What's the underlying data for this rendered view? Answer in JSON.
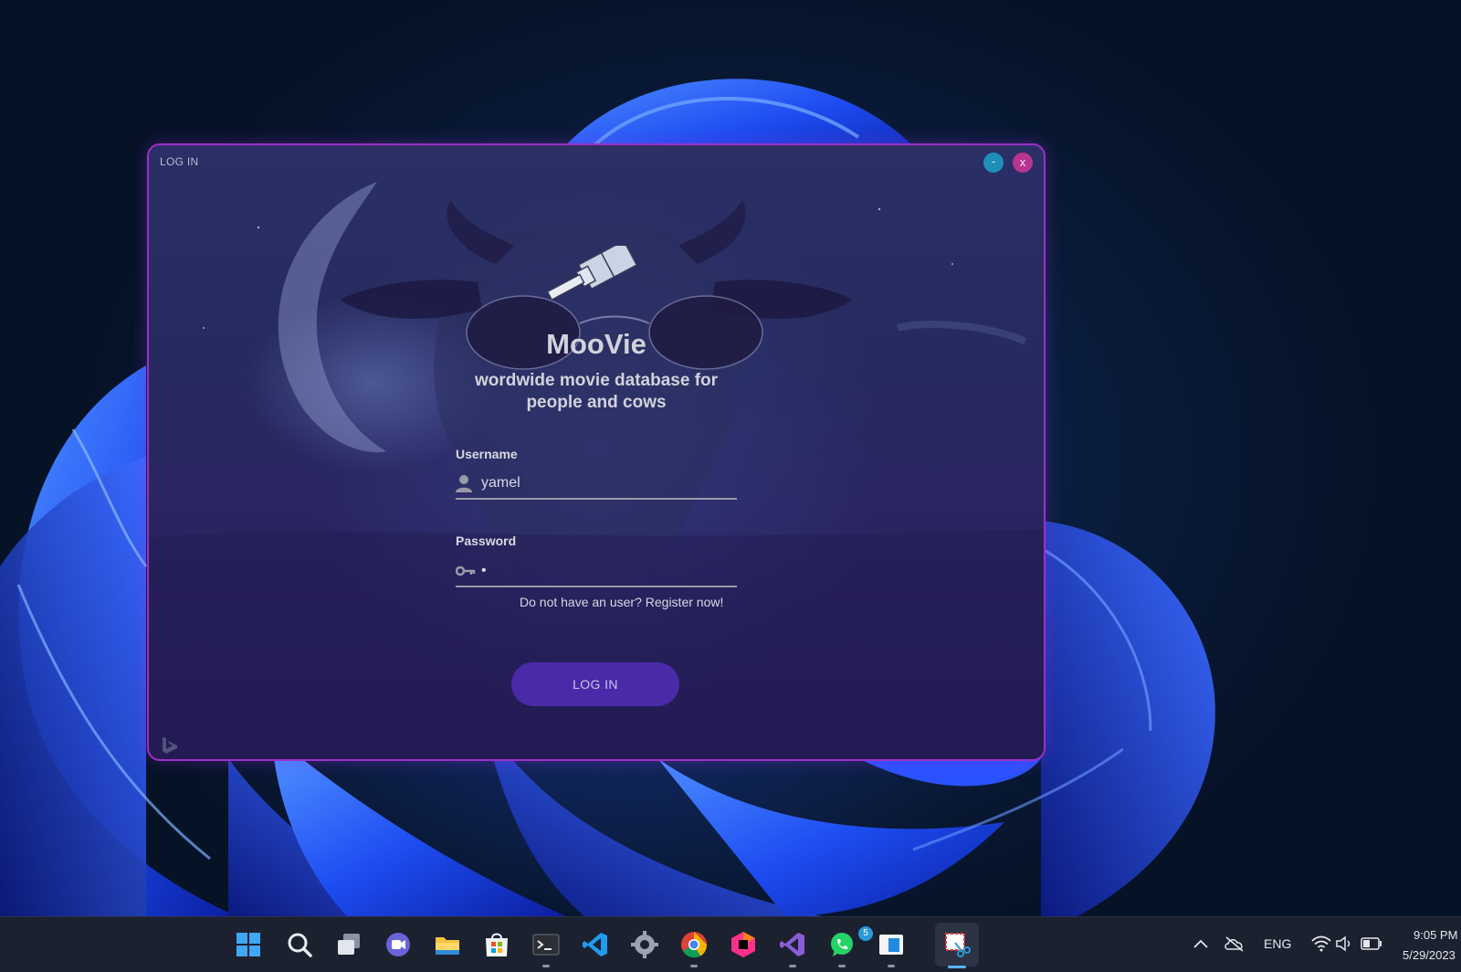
{
  "window": {
    "title": "LOG IN",
    "minimize_label": "-",
    "close_label": "x"
  },
  "brand": {
    "name": "MooVie",
    "tagline": "wordwide movie database for people and cows"
  },
  "form": {
    "username_label": "Username",
    "username_value": "yamel",
    "password_label": "Password",
    "password_value": "•",
    "register_text": "Do not have an user? Register now!",
    "login_button": "LOG IN"
  },
  "taskbar": {
    "pinned": [
      "start-icon",
      "search-icon",
      "task-view-icon",
      "teams-chat-icon",
      "file-explorer-icon",
      "microsoft-store-icon",
      "terminal-icon",
      "vscode-icon",
      "settings-icon",
      "chrome-icon",
      "jetbrains-toolbox-icon",
      "visual-studio-icon",
      "whatsapp-icon",
      "notepad-icon",
      "snipping-tool-icon"
    ],
    "whatsapp_badge": "5",
    "language": "ENG",
    "time": "9:05 PM",
    "date": "5/29/2023"
  },
  "colors": {
    "window_border": "#9d2fc8",
    "login_button": "#4a2aa8",
    "minimize": "#1f8fb8",
    "close": "#b7358f",
    "wallpaper_bloom": "#1f4fff"
  }
}
